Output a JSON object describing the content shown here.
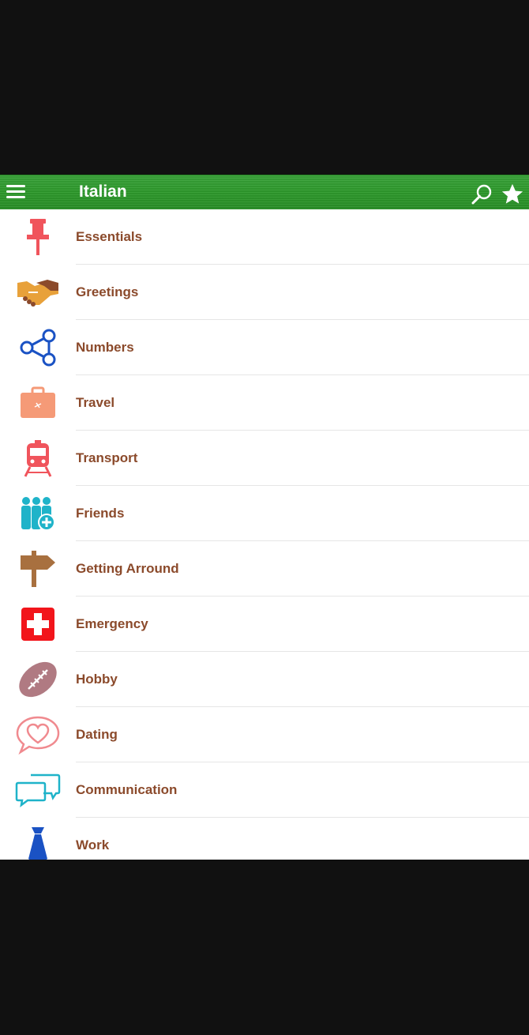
{
  "appbar": {
    "title": "Italian",
    "menu_icon": "hamburger-icon",
    "search_icon": "search-icon",
    "favorites_icon": "star-icon",
    "color": "#2e9a2c"
  },
  "categories": [
    {
      "label": "Essentials",
      "icon": "pushpin-icon",
      "color": "#f0545c"
    },
    {
      "label": "Greetings",
      "icon": "handshake-icon",
      "color": "#e8a13a"
    },
    {
      "label": "Numbers",
      "icon": "share-nodes-icon",
      "color": "#1a52c4"
    },
    {
      "label": "Travel",
      "icon": "suitcase-icon",
      "color": "#f59a77"
    },
    {
      "label": "Transport",
      "icon": "train-icon",
      "color": "#f0545c"
    },
    {
      "label": "Friends",
      "icon": "add-friends-icon",
      "color": "#1fb3c9"
    },
    {
      "label": "Getting Arround",
      "icon": "signpost-icon",
      "color": "#a8703f"
    },
    {
      "label": "Emergency",
      "icon": "first-aid-icon",
      "color": "#f2151b"
    },
    {
      "label": "Hobby",
      "icon": "football-icon",
      "color": "#b07a82"
    },
    {
      "label": "Dating",
      "icon": "heart-bubble-icon",
      "color": "#f08a8f"
    },
    {
      "label": "Communication",
      "icon": "chat-bubbles-icon",
      "color": "#1fb3c9"
    },
    {
      "label": "Work",
      "icon": "necktie-icon",
      "color": "#1a52c4"
    }
  ]
}
